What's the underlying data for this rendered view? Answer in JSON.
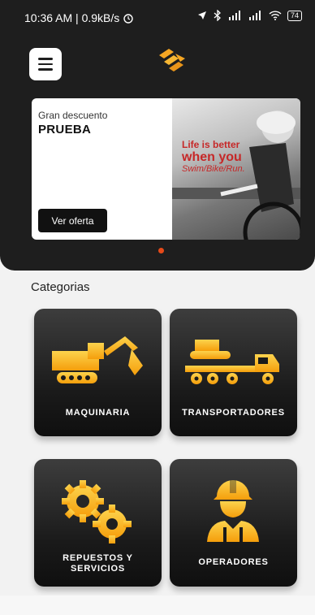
{
  "status_bar": {
    "time_speed": "10:36 AM | 0.9kB/s",
    "battery": "74"
  },
  "header": {
    "menu_icon": "menu-icon",
    "logo_icon": "brand-logo-icon"
  },
  "banner": {
    "subtitle": "Gran descuento",
    "title": "PRUEBA",
    "button_label": "Ver oferta",
    "image_tagline_1": "Life is better",
    "image_tagline_2": "when you",
    "image_tagline_3": "Swim/Bike/Run."
  },
  "categories": {
    "heading": "Categorias",
    "items": [
      {
        "label": "maquinaria",
        "icon": "excavator-icon"
      },
      {
        "label": "transportadores",
        "icon": "truck-icon"
      },
      {
        "label": "repuestos y\nservicios",
        "icon": "gears-icon"
      },
      {
        "label": "operadores",
        "icon": "worker-icon"
      }
    ]
  },
  "colors": {
    "accent": "#f5a623",
    "header_bg": "#1e1e1e",
    "dot": "#e64a19"
  }
}
